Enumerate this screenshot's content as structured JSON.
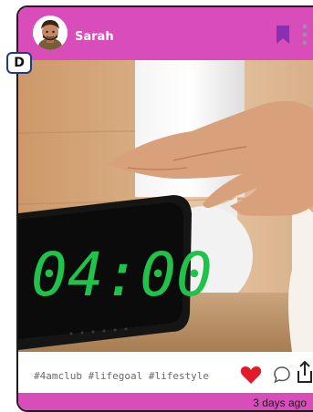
{
  "badge": {
    "letter": "D"
  },
  "post": {
    "username": "Sarah",
    "hashtags": "#4amclub #lifegoal #lifestyle",
    "timestamp": "3 days ago",
    "liked": true
  },
  "photo": {
    "clock_time": "04:00"
  },
  "icons": {
    "avatar": "avatar",
    "bookmark": "bookmark-icon",
    "more": "more-vertical-icon",
    "like": "heart-icon",
    "comment": "comment-icon",
    "share": "share-icon"
  },
  "colors": {
    "accent": "#d94dba",
    "bookmark": "#8a2fb0",
    "heart": "#e01b2a"
  }
}
